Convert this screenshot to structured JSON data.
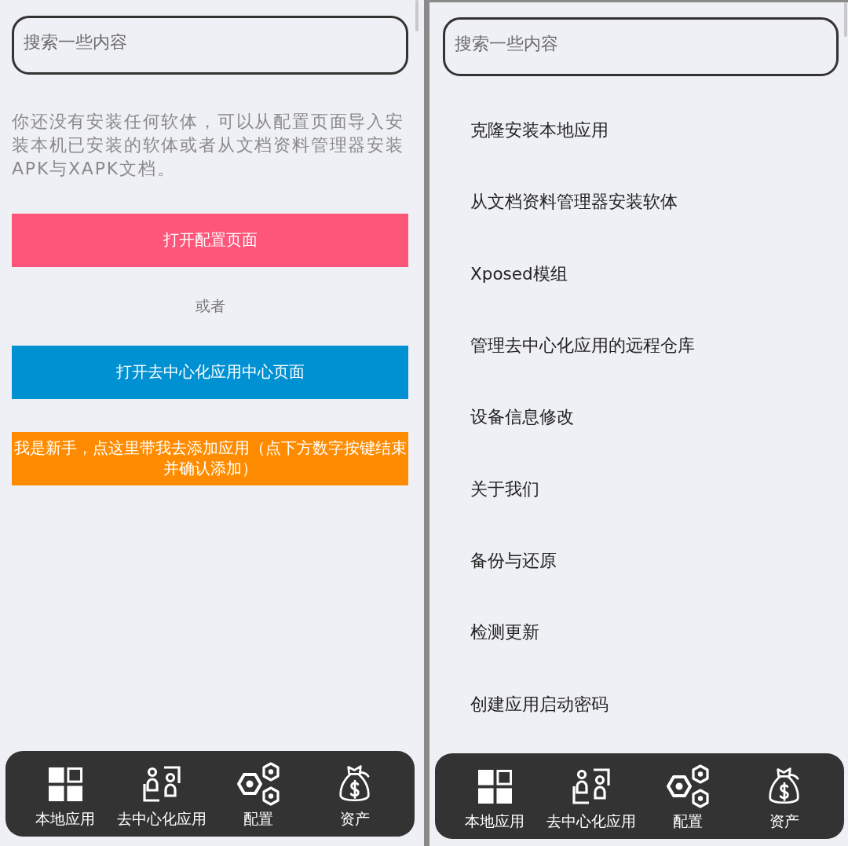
{
  "screens": [
    {
      "kind": "empty_state",
      "search": {
        "placeholder": "搜索一些内容"
      },
      "message": "你还没有安装任何软体，可以从配置页面导入安装本机已安装的软体或者从文档资料管理器安装APK与XAPK文档。",
      "actions": [
        {
          "kind": "button",
          "label": "打开配置页面",
          "color": "#fe557a"
        },
        {
          "kind": "text",
          "label": "或者"
        },
        {
          "kind": "button",
          "label": "打开去中心化应用中心页面",
          "color": "#0091d3"
        },
        {
          "kind": "button",
          "label": "我是新手，点这里带我去添加应用（点下方数字按键结束并确认添加）",
          "color": "#ff8c00"
        }
      ],
      "nav": [
        {
          "kind": "grid",
          "label": "本地应用"
        },
        {
          "kind": "people",
          "label": "去中心化应用"
        },
        {
          "kind": "hexagons",
          "label": "配置"
        },
        {
          "kind": "money_bag",
          "label": "资产"
        }
      ]
    },
    {
      "kind": "menu",
      "search": {
        "placeholder": "搜索一些内容"
      },
      "menu": [
        "克隆安装本地应用",
        "从文档资料管理器安装软体",
        "Xposed模组",
        "管理去中心化应用的远程仓库",
        "设备信息修改",
        "关于我们",
        "备份与还原",
        "检测更新",
        "创建应用启动密码"
      ],
      "nav": [
        {
          "kind": "grid",
          "label": "本地应用"
        },
        {
          "kind": "people",
          "label": "去中心化应用"
        },
        {
          "kind": "hexagons",
          "label": "配置"
        },
        {
          "kind": "money_bag",
          "label": "资产"
        }
      ]
    }
  ]
}
